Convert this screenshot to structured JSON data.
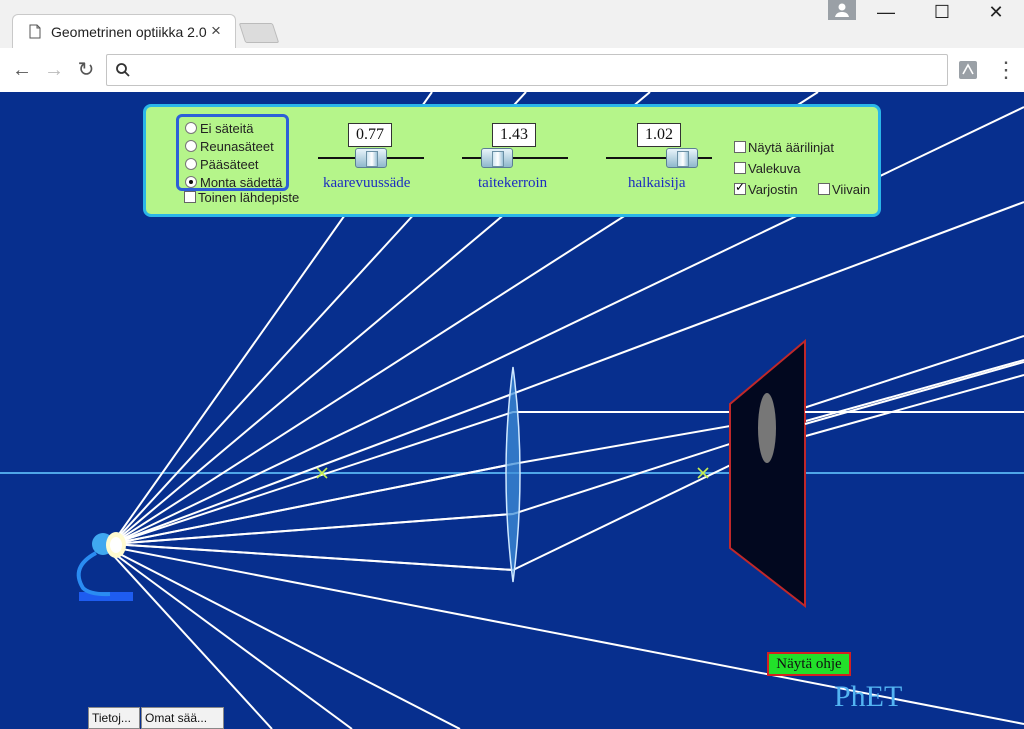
{
  "browser": {
    "tab_title": "Geometrinen optiikka 2.0",
    "tab_close_icon": "close-icon",
    "window_controls": {
      "minimize": "—",
      "maximize": "☐",
      "close": "✕"
    },
    "back_icon": "←",
    "forward_icon": "→",
    "reload_icon": "↻",
    "search_icon": "search-icon",
    "address_value": "",
    "menu_icon": "⋮"
  },
  "panel": {
    "ray_options": [
      {
        "label": "Ei säteitä",
        "selected": false
      },
      {
        "label": "Reunasäteet",
        "selected": false
      },
      {
        "label": "Pääsäteet",
        "selected": false
      },
      {
        "label": "Monta sädettä",
        "selected": true
      }
    ],
    "second_source": {
      "label": "Toinen lähdepiste",
      "checked": false
    },
    "sliders": [
      {
        "label": "kaarevuussäde",
        "value": "0.77",
        "fraction": 0.5
      },
      {
        "label": "taitekerroin",
        "value": "1.43",
        "fraction": 0.3
      },
      {
        "label": "halkaisija",
        "value": "1.02",
        "fraction": 0.72
      }
    ],
    "checkboxes": {
      "show_virtual": {
        "label": "Näytä äärilinjat",
        "checked": false
      },
      "virtual_image": {
        "label": "Valekuva",
        "checked": false
      },
      "screen": {
        "label": "Varjostin",
        "checked": true
      },
      "guides": {
        "label": "Viivain",
        "checked": false
      }
    }
  },
  "help_button": "Näytä ohje",
  "logo": "PhET",
  "bottom_buttons": {
    "about": "Tietoj...",
    "preferences": "Omat sää..."
  },
  "colors": {
    "background": "#072f8e",
    "panel": "#b5f58a",
    "rays": "#ffffff",
    "axis": "#4fa6e8",
    "focal_marker": "#c8f050",
    "screen_edge": "#c0282a"
  }
}
